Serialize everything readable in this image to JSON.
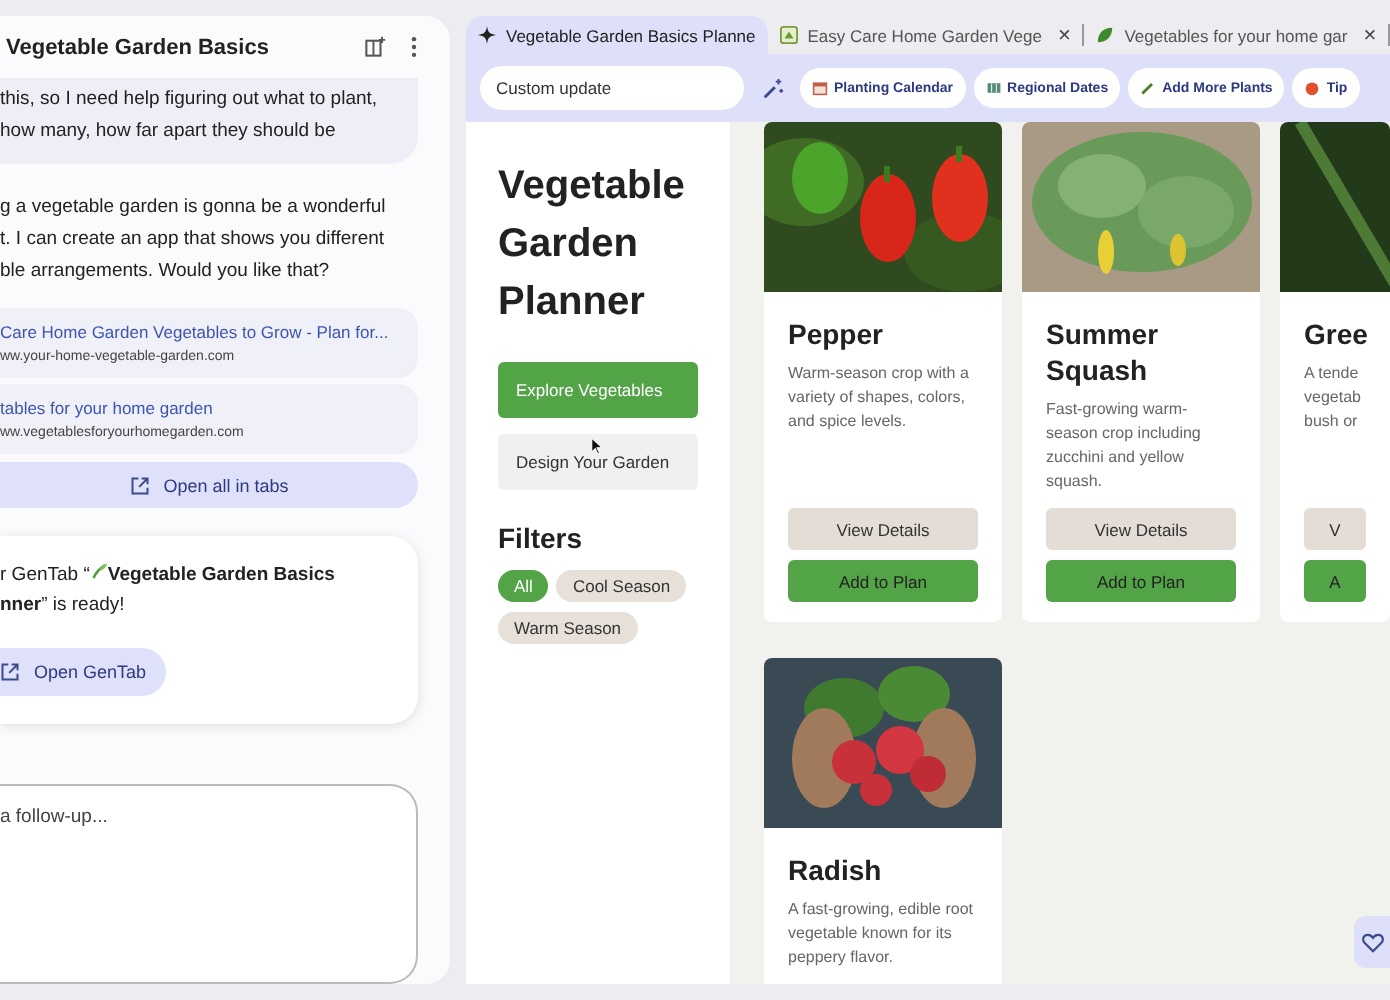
{
  "chat": {
    "title": "Vegetable Garden Basics",
    "user_message": "this, so I need help figuring out what to plant,\nhow many, how far apart they should be",
    "reply": "g a vegetable garden is gonna be a wonderful\nt. I can create an app that shows you different\nble arrangements. Would you like that?",
    "sources": [
      {
        "title": "Care Home Garden Vegetables to Grow - Plan for...",
        "url": "ww.your-home-vegetable-garden.com"
      },
      {
        "title": "tables for your home garden",
        "url": "ww.vegetablesforyourhomegarden.com"
      }
    ],
    "open_all": "Open all in tabs",
    "gentab": {
      "prefix": "r GenTab “",
      "title_start": "Vegetable Garden Basics",
      "line2": "**nner**” is ready!",
      "button": "Open GenTab"
    },
    "followup": {
      "placeholder": "a follow-up..."
    }
  },
  "browser": {
    "tabs": [
      {
        "title": "Vegetable Garden Basics Planne",
        "kind": "sparkle",
        "selected": true
      },
      {
        "title": "Easy Care Home Garden Vege",
        "kind": "page",
        "selected": false,
        "close": "×"
      },
      {
        "title": "Vegetables for your home gar",
        "kind": "leaf",
        "selected": false,
        "close": "×"
      }
    ],
    "custom_update": {
      "placeholder": "Custom update"
    },
    "chips": [
      {
        "label": "Planting Calendar",
        "kind": "calendar"
      },
      {
        "label": "Regional Dates",
        "kind": "map"
      },
      {
        "label": "Add More Plants",
        "kind": "pencil"
      },
      {
        "label": "Tip",
        "kind": "dot"
      }
    ]
  },
  "planner": {
    "title": "Vegetable Garden Planner",
    "actions": [
      {
        "label": "Explore Vegetables",
        "kind": "primary"
      },
      {
        "label": "Design Your Garden",
        "kind": "secondary"
      }
    ],
    "filters_heading": "Filters",
    "filters": [
      {
        "label": "All",
        "selected": true
      },
      {
        "label": "Cool Season",
        "selected": false
      },
      {
        "label": "Warm Season",
        "selected": false
      }
    ],
    "cards": [
      {
        "name": "Pepper",
        "kind": "pepper",
        "description": "Warm-season crop with a variety of shapes, colors, and spice levels.",
        "buttons": [
          {
            "label": "View Details",
            "kind": "secondary"
          },
          {
            "label": "Add to Plan",
            "kind": "primary"
          }
        ]
      },
      {
        "name": "Summer Squash",
        "kind": "squash",
        "description": "Fast-growing warm-season crop including zucchini and yellow squash.",
        "buttons": [
          {
            "label": "View Details",
            "kind": "secondary"
          },
          {
            "label": "Add to Plan",
            "kind": "primary"
          }
        ]
      },
      {
        "name": "Gree",
        "kind": "greens",
        "description": "A tende\nvegetab\nbush or",
        "buttons": [
          {
            "label": "V",
            "kind": "secondary"
          },
          {
            "label": "A",
            "kind": "primary"
          }
        ]
      },
      {
        "name": "Radish",
        "kind": "radish",
        "description": "A fast-growing, edible root vegetable known for its peppery flavor."
      }
    ]
  }
}
